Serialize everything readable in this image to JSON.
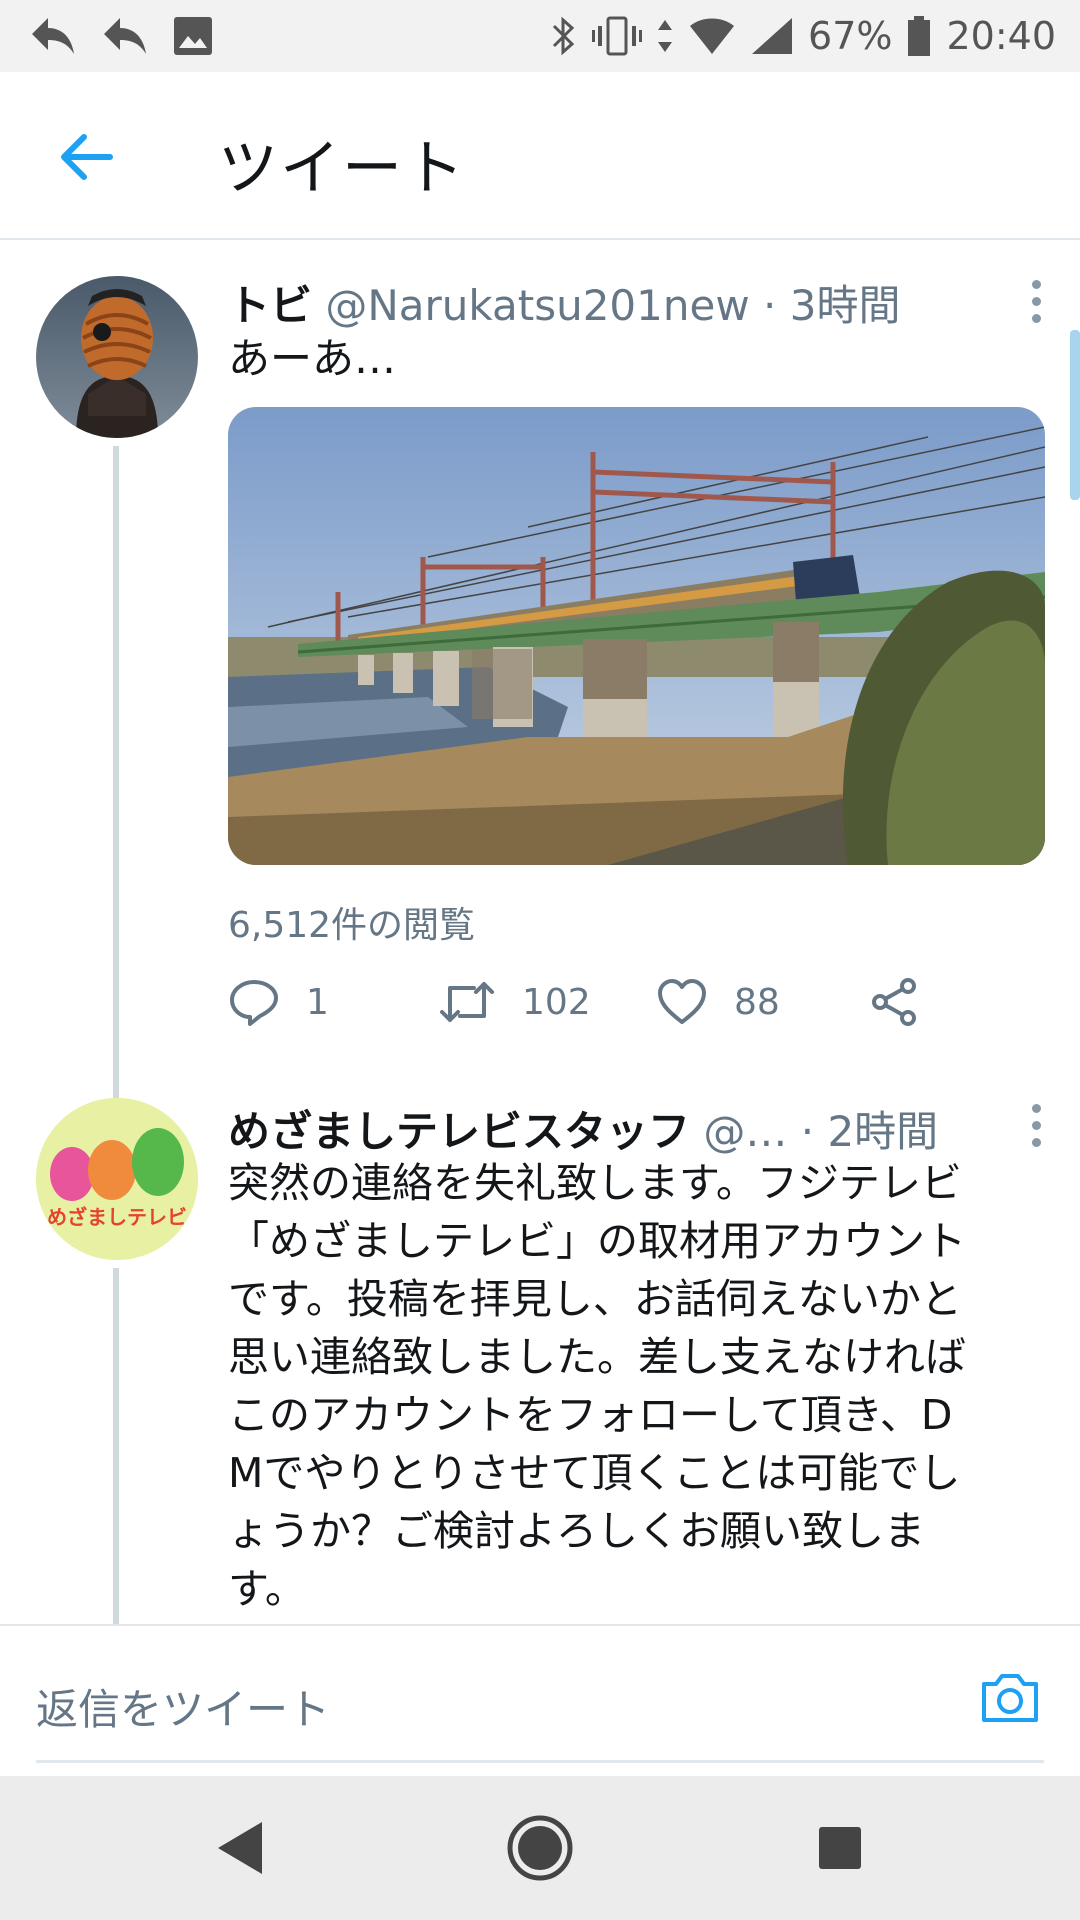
{
  "status_bar": {
    "battery": "67%",
    "time": "20:40"
  },
  "header": {
    "title": "ツイート"
  },
  "tweets": [
    {
      "name": "トビ",
      "handle": "@Narukatsu201new",
      "separator": "·",
      "time": "3時間",
      "text": "あーあ…",
      "views": "6,512件の閲覧",
      "reply_count": "1",
      "retweet_count": "102",
      "like_count": "88"
    },
    {
      "name": "めざましテレビスタッフ",
      "handle": "@…",
      "separator": "·",
      "time": "2時間",
      "text_lines": [
        "突然の連絡を失礼致します。フジテレビ",
        "「めざましテレビ」の取材用アカウント",
        "です。投稿を拝見し、お話伺えないかと",
        "思い連絡致しました。差し支えなければ",
        "このアカウントをフォローして頂き、D",
        "Mでやりとりさせて頂くことは可能でし",
        "ょうか？ご検討よろしくお願い致しま",
        "す。"
      ],
      "avatar_text": "めざましテレビ"
    }
  ],
  "reply_bar": {
    "placeholder": "返信をツイート"
  },
  "colors": {
    "accent": "#1da1f2",
    "secondary_text": "#657786"
  },
  "icons": [
    "undo-icon",
    "reply-icon",
    "image-icon",
    "bluetooth-icon",
    "vibrate-icon",
    "data-icon",
    "wifi-icon",
    "signal-icon",
    "battery-icon",
    "back-arrow-icon",
    "more-icon",
    "reply-icon",
    "retweet-icon",
    "like-icon",
    "share-icon",
    "camera-icon",
    "nav-back-icon",
    "nav-home-icon",
    "nav-recents-icon"
  ]
}
